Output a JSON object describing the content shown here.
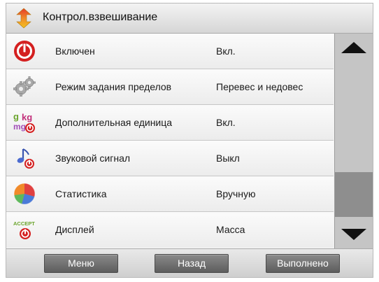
{
  "header": {
    "title": "Контрол.взвешивание",
    "icon": "up-down-arrow-icon"
  },
  "items": [
    {
      "label": "Включен",
      "value": "Вкл.",
      "icon": "power-icon"
    },
    {
      "label": "Режим задания пределов",
      "value": "Перевес и недовес",
      "icon": "gears-icon"
    },
    {
      "label": "Дополнительная единица",
      "value": "Вкл.",
      "icon": "units-icon",
      "icon_text": [
        "g",
        "kg",
        "mg"
      ]
    },
    {
      "label": "Звуковой сигнал",
      "value": "Выкл",
      "icon": "music-note-icon"
    },
    {
      "label": "Статистика",
      "value": "Вручную",
      "icon": "pie-chart-icon"
    },
    {
      "label": "Дисплей",
      "value": "Масса",
      "icon": "accept-icon",
      "icon_text": "ACCEPT"
    }
  ],
  "footer": {
    "menu_label": "Меню",
    "back_label": "Назад",
    "done_label": "Выполнено"
  },
  "colors": {
    "power_red": "#d42020",
    "title_arrow_top": "#e53a2a",
    "title_arrow_bottom": "#f0c020",
    "button": "#6e6e6e"
  }
}
